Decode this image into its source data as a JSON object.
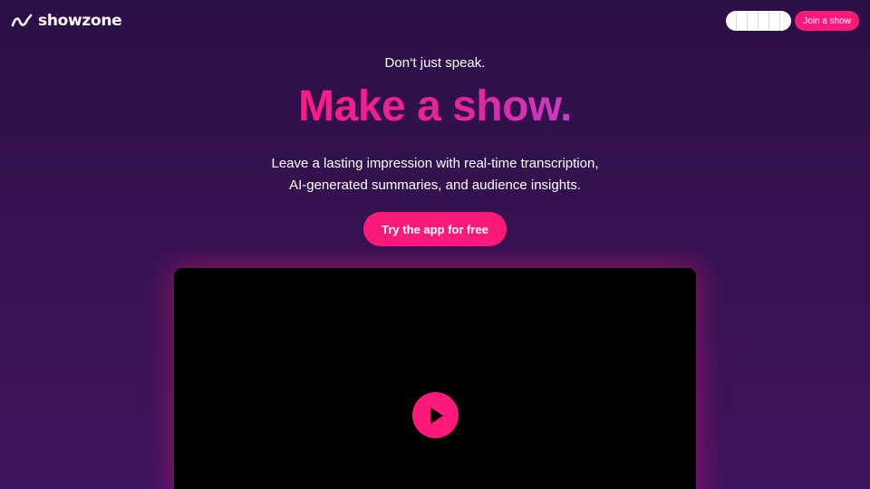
{
  "header": {
    "logo_text": "showzone",
    "join_label": "Join a show"
  },
  "hero": {
    "tagline": "Don‘t just speak.",
    "headline": "Make a show.",
    "subtitle_line1": "Leave a lasting impression with real-time transcription,",
    "subtitle_line2": "AI-generated summaries, and audience insights.",
    "cta_label": "Try the app for free"
  },
  "video": {
    "play_icon": "play-icon"
  },
  "colors": {
    "accent": "#ff1a7a",
    "background": "#34124f"
  }
}
